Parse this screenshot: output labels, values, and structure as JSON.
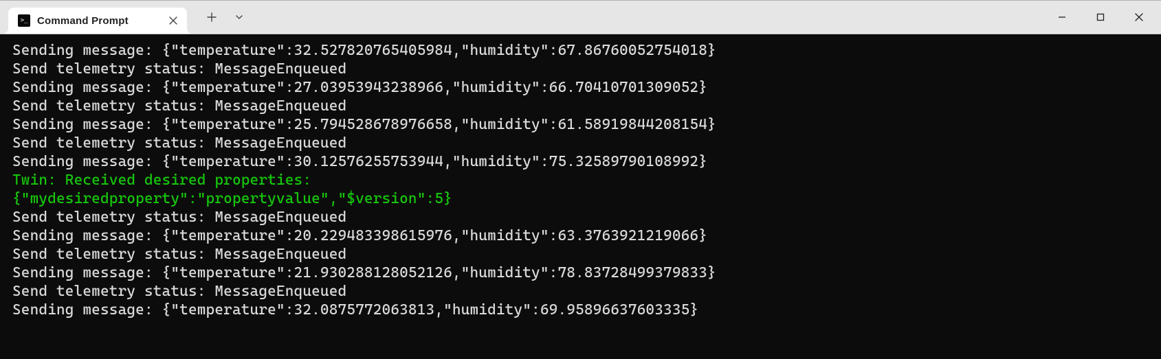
{
  "colors": {
    "terminal_bg": "#0c0c0c",
    "terminal_fg": "#d9d9d9",
    "highlight": "#16c60c",
    "titlebar": "#e6e6e6",
    "tab_bg": "#ffffff"
  },
  "titlebar": {
    "tab_title": "Command Prompt",
    "tab_icon_name": "terminal-icon",
    "close_tab_tooltip": "Close tab",
    "new_tab_tooltip": "New tab",
    "dropdown_tooltip": "New tab dropdown"
  },
  "window_controls": {
    "minimize_tooltip": "Minimize",
    "maximize_tooltip": "Maximize",
    "close_tooltip": "Close"
  },
  "terminal": {
    "lines": [
      {
        "t": "Sending message: {\"temperature\":32.527820765405984,\"humidity\":67.86760052754018}",
        "c": "normal"
      },
      {
        "t": "Send telemetry status: MessageEnqueued",
        "c": "normal"
      },
      {
        "t": "Sending message: {\"temperature\":27.03953943238966,\"humidity\":66.70410701309052}",
        "c": "normal"
      },
      {
        "t": "Send telemetry status: MessageEnqueued",
        "c": "normal"
      },
      {
        "t": "Sending message: {\"temperature\":25.794528678976658,\"humidity\":61.58919844208154}",
        "c": "normal"
      },
      {
        "t": "Send telemetry status: MessageEnqueued",
        "c": "normal"
      },
      {
        "t": "Sending message: {\"temperature\":30.12576255753944,\"humidity\":75.32589790108992}",
        "c": "normal"
      },
      {
        "t": "Twin: Received desired properties:",
        "c": "green"
      },
      {
        "t": "{\"mydesiredproperty\":\"propertyvalue\",\"$version\":5}",
        "c": "green"
      },
      {
        "t": "Send telemetry status: MessageEnqueued",
        "c": "normal"
      },
      {
        "t": "Sending message: {\"temperature\":20.229483398615976,\"humidity\":63.3763921219066}",
        "c": "normal"
      },
      {
        "t": "Send telemetry status: MessageEnqueued",
        "c": "normal"
      },
      {
        "t": "Sending message: {\"temperature\":21.930288128052126,\"humidity\":78.83728499379833}",
        "c": "normal"
      },
      {
        "t": "Send telemetry status: MessageEnqueued",
        "c": "normal"
      },
      {
        "t": "Sending message: {\"temperature\":32.0875772063813,\"humidity\":69.95896637603335}",
        "c": "normal"
      }
    ]
  }
}
